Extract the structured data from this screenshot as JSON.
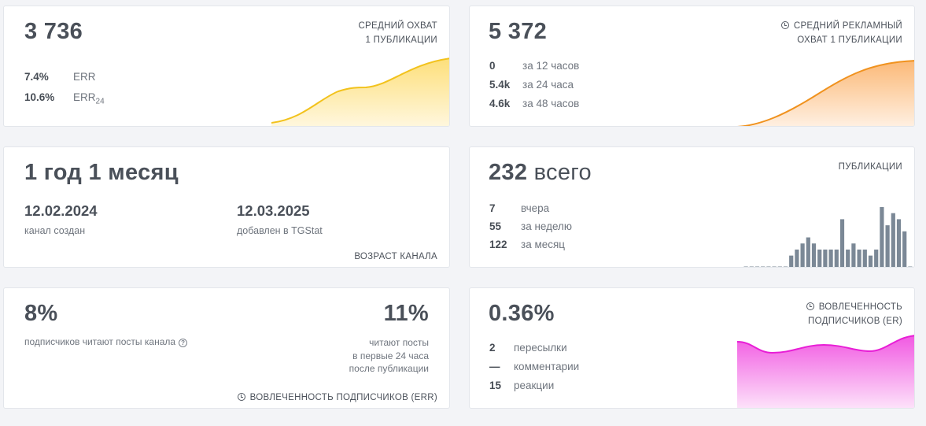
{
  "reach": {
    "value": "3 736",
    "caption_1": "СРЕДНИЙ ОХВАТ",
    "caption_2": "1 ПУБЛИКАЦИИ",
    "err_value": "7.4%",
    "err_label": "ERR",
    "err24_value": "10.6%",
    "err24_label": "ERR",
    "err24_sub": "24",
    "line_color": "#f2c21c"
  },
  "ad_reach": {
    "value": "5 372",
    "caption_1": "СРЕДНИЙ РЕКЛАМНЫЙ",
    "caption_2": "ОХВАТ 1 ПУБЛИКАЦИИ",
    "rows": [
      {
        "value": "0",
        "label": "за 12 часов"
      },
      {
        "value": "5.4k",
        "label": "за 24 часа"
      },
      {
        "value": "4.6k",
        "label": "за 48 часов"
      }
    ],
    "line_color": "#f0921e"
  },
  "age": {
    "value": "1 год 1 месяц",
    "created_date": "12.02.2024",
    "created_label": "канал создан",
    "added_date": "12.03.2025",
    "added_label": "добавлен в TGStat",
    "caption": "ВОЗРАСТ КАНАЛА"
  },
  "posts": {
    "value": "232",
    "value_suffix": "всего",
    "caption": "ПУБЛИКАЦИИ",
    "rows": [
      {
        "value": "7",
        "label": "вчера"
      },
      {
        "value": "55",
        "label": "за неделю"
      },
      {
        "value": "122",
        "label": "за месяц"
      }
    ],
    "bar_color": "#7b8896",
    "bars": [
      0,
      0,
      0,
      0,
      0,
      0,
      0,
      0,
      2,
      3,
      4,
      5,
      4,
      3,
      3,
      3,
      3,
      8,
      3,
      4,
      3,
      3,
      2,
      3,
      10,
      7,
      9,
      8,
      6,
      0
    ]
  },
  "err_engagement": {
    "left_value": "8%",
    "left_label": "подписчиков читают посты канала",
    "right_value": "11%",
    "right_label_1": "читают посты",
    "right_label_2": "в первые 24 часа",
    "right_label_3": "после публикации",
    "caption": "ВОВЛЕЧЕННОСТЬ ПОДПИСЧИКОВ (ERR)"
  },
  "er_engagement": {
    "value": "0.36%",
    "caption_1": "ВОВЛЕЧЕННОСТЬ",
    "caption_2": "ПОДПИСЧИКОВ (ER)",
    "rows": [
      {
        "value": "2",
        "label": "пересылки"
      },
      {
        "value": "—",
        "label": "комментарии"
      },
      {
        "value": "15",
        "label": "реакции"
      }
    ],
    "line_color": "#e81ed6"
  }
}
